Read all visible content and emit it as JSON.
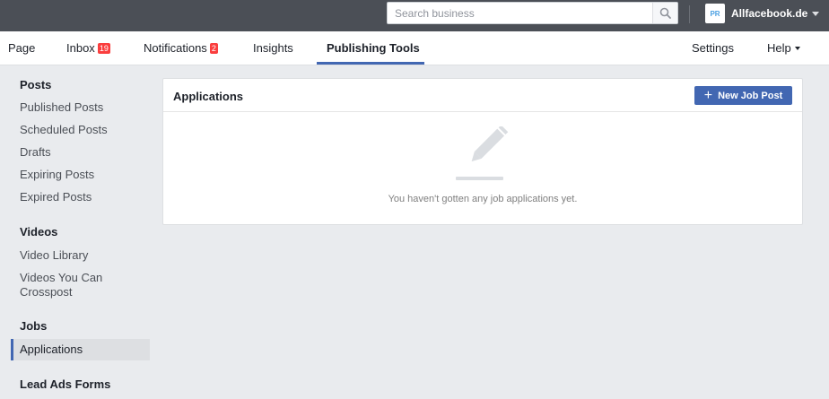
{
  "topbar": {
    "search_placeholder": "Search business",
    "account_initials": "PR",
    "account_name": "Allfacebook.de"
  },
  "nav": {
    "page": "Page",
    "inbox": "Inbox",
    "inbox_count": "19",
    "notifications": "Notifications",
    "notifications_count": "2",
    "insights": "Insights",
    "publishing_tools": "Publishing Tools",
    "settings": "Settings",
    "help": "Help"
  },
  "sidebar": {
    "posts_heading": "Posts",
    "published_posts": "Published Posts",
    "scheduled_posts": "Scheduled Posts",
    "drafts": "Drafts",
    "expiring_posts": "Expiring Posts",
    "expired_posts": "Expired Posts",
    "videos_heading": "Videos",
    "video_library": "Video Library",
    "videos_crosspost": "Videos You Can Crosspost",
    "jobs_heading": "Jobs",
    "applications": "Applications",
    "lead_ads_heading": "Lead Ads Forms"
  },
  "main": {
    "title": "Applications",
    "new_job_post": "New Job Post",
    "empty_message": "You haven't gotten any job applications yet."
  },
  "colors": {
    "topbar": "#4b4f56",
    "accent": "#4267b2",
    "badge": "#fa3e3e"
  }
}
